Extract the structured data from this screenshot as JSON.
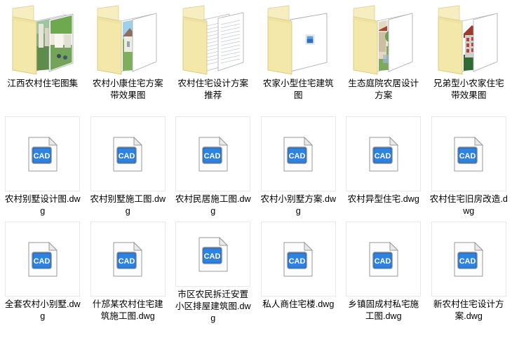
{
  "window": {
    "background_color": "#ffffff",
    "view": "large-icons",
    "columns": 6,
    "rows": 3
  },
  "colors": {
    "folder_front": "#f5e9b0",
    "folder_back": "#f7efc3",
    "folder_edge": "#d9c882",
    "sheet_white": "#ffffff",
    "sheet_edge": "#b9b9b9",
    "cad_blue": "#1f6fd0",
    "cad_blue_dark": "#0b4f9e",
    "file_box_border": "#e8e8e8",
    "label_text": "#000000"
  },
  "items": [
    {
      "name": "江西农村住宅图集",
      "type": "folder",
      "icon": "folder-with-photos-icon",
      "thumb": "photo-landscape-green"
    },
    {
      "name": "农村小康住宅方案带效果图",
      "type": "folder",
      "icon": "folder-with-photos-icon",
      "thumb": "photo-house-sky"
    },
    {
      "name": "农村住宅设计方案推荐",
      "type": "folder",
      "icon": "folder-with-documents-icon",
      "thumb": "lined-documents"
    },
    {
      "name": "农家小型住宅建筑图",
      "type": "folder",
      "icon": "folder-with-file-icon",
      "thumb": "small-blue-file"
    },
    {
      "name": "生态庭院农居设计方案",
      "type": "folder",
      "icon": "folder-with-photos-icon",
      "thumb": "photo-courtyard"
    },
    {
      "name": "兄弟型小农家住宅带效果图",
      "type": "folder",
      "icon": "folder-with-photos-icon",
      "thumb": "photo-red-roof-building"
    },
    {
      "name": "农村别墅设计图.dwg",
      "type": "file",
      "icon": "cad-dwg-icon",
      "extension": "dwg",
      "icon_text": "CAD"
    },
    {
      "name": "农村别墅施工图.dwg",
      "type": "file",
      "icon": "cad-dwg-icon",
      "extension": "dwg",
      "icon_text": "CAD"
    },
    {
      "name": "农村民居施工图.dwg",
      "type": "file",
      "icon": "cad-dwg-icon",
      "extension": "dwg",
      "icon_text": "CAD"
    },
    {
      "name": "农村小别墅方案.dwg",
      "type": "file",
      "icon": "cad-dwg-icon",
      "extension": "dwg",
      "icon_text": "CAD"
    },
    {
      "name": "农村异型住宅.dwg",
      "type": "file",
      "icon": "cad-dwg-icon",
      "extension": "dwg",
      "icon_text": "CAD"
    },
    {
      "name": "农村住宅旧房改造.dwg",
      "type": "file",
      "icon": "cad-dwg-icon",
      "extension": "dwg",
      "icon_text": "CAD"
    },
    {
      "name": "全套农村小别墅.dwg",
      "type": "file",
      "icon": "cad-dwg-icon",
      "extension": "dwg",
      "icon_text": "CAD"
    },
    {
      "name": "什邡某农村住宅建筑施工图.dwg",
      "type": "file",
      "icon": "cad-dwg-icon",
      "extension": "dwg",
      "icon_text": "CAD"
    },
    {
      "name": "市区农民拆迁安置小区排屋建筑图.dwg",
      "type": "file",
      "icon": "cad-dwg-icon",
      "extension": "dwg",
      "icon_text": "CAD"
    },
    {
      "name": "私人商住宅楼.dwg",
      "type": "file",
      "icon": "cad-dwg-icon",
      "extension": "dwg",
      "icon_text": "CAD"
    },
    {
      "name": "乡镇固成村私宅施工图.dwg",
      "type": "file",
      "icon": "cad-dwg-icon",
      "extension": "dwg",
      "icon_text": "CAD"
    },
    {
      "name": "新农村住宅设计方案.dwg",
      "type": "file",
      "icon": "cad-dwg-icon",
      "extension": "dwg",
      "icon_text": "CAD"
    }
  ]
}
